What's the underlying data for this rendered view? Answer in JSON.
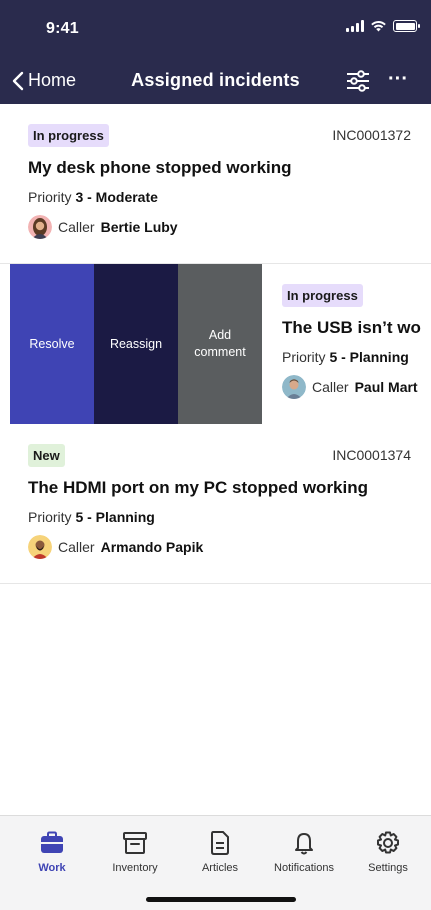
{
  "status": {
    "time": "9:41"
  },
  "nav": {
    "back_label": "Home",
    "title": "Assigned incidents",
    "more_label": "···"
  },
  "incidents": [
    {
      "state": "In progress",
      "number": "INC0001372",
      "title": "My desk phone stopped working",
      "priority_label": "Priority",
      "priority_value": "3 - Moderate",
      "caller_label": "Caller",
      "caller_name": "Bertie Luby"
    },
    {
      "state": "In progress",
      "number": "",
      "title": "The USB isn’t wo",
      "priority_label": "Priority",
      "priority_value": "5 - Planning",
      "caller_label": "Caller",
      "caller_name": "Paul Mart"
    },
    {
      "state": "New",
      "number": "INC0001374",
      "title": "The HDMI port on my PC stopped working",
      "priority_label": "Priority",
      "priority_value": "5 - Planning",
      "caller_label": "Caller",
      "caller_name": "Armando Papik"
    }
  ],
  "swipe_actions": {
    "resolve": "Resolve",
    "reassign": "Reassign",
    "add_comment": "Add\ncomment"
  },
  "tabs": [
    {
      "label": "Work",
      "icon": "briefcase-icon",
      "active": true
    },
    {
      "label": "Inventory",
      "icon": "archive-box-icon"
    },
    {
      "label": "Articles",
      "icon": "document-icon"
    },
    {
      "label": "Notifications",
      "icon": "bell-icon"
    },
    {
      "label": "Settings",
      "icon": "gear-icon"
    }
  ],
  "colors": {
    "header_bg": "#2a2b4d",
    "accent": "#3f44b4",
    "in_progress_badge": "#e6dcfb",
    "new_badge": "#e0f1da"
  }
}
